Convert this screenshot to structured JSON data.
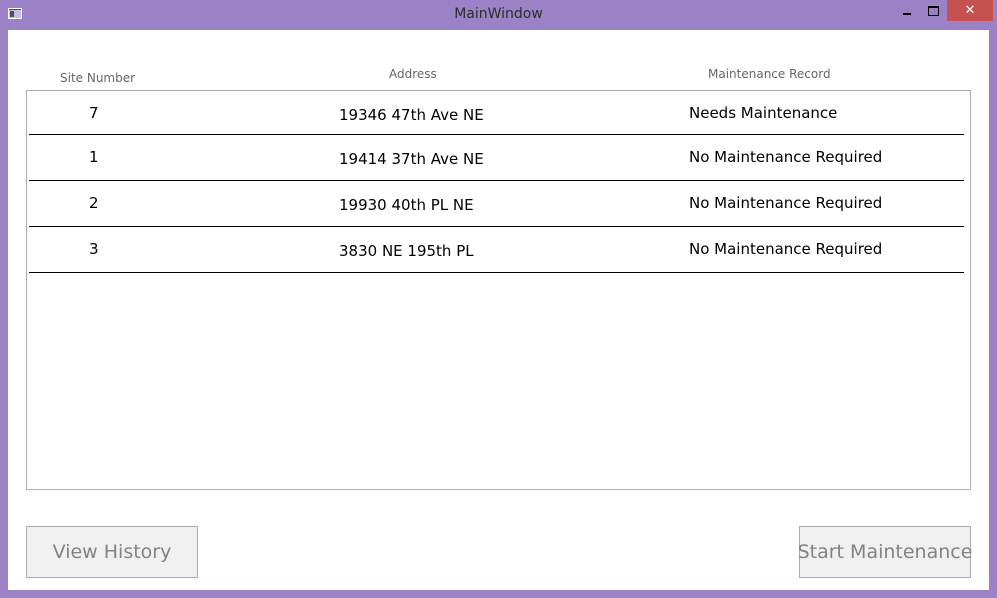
{
  "window": {
    "title": "MainWindow",
    "minimize_symbol": "",
    "close_symbol": "✕",
    "accent": "#9b82c6",
    "close_color": "#c75050"
  },
  "icons": {
    "app": "app-window-icon",
    "minimize": "minimize-icon",
    "maximize": "maximize-icon",
    "close": "close-icon"
  },
  "table": {
    "headers": {
      "site": "Site Number",
      "address": "Address",
      "maintenance": "Maintenance Record"
    },
    "rows": [
      {
        "site": "7",
        "address": "19346 47th Ave NE",
        "maintenance": "Needs Maintenance"
      },
      {
        "site": "1",
        "address": "19414 37th Ave NE",
        "maintenance": "No Maintenance Required"
      },
      {
        "site": "2",
        "address": "19930 40th PL NE",
        "maintenance": "No Maintenance Required"
      },
      {
        "site": "3",
        "address": "3830 NE 195th PL",
        "maintenance": "No Maintenance Required"
      }
    ]
  },
  "buttons": {
    "view_history": "View History",
    "start_maintenance": "Start Maintenance"
  }
}
